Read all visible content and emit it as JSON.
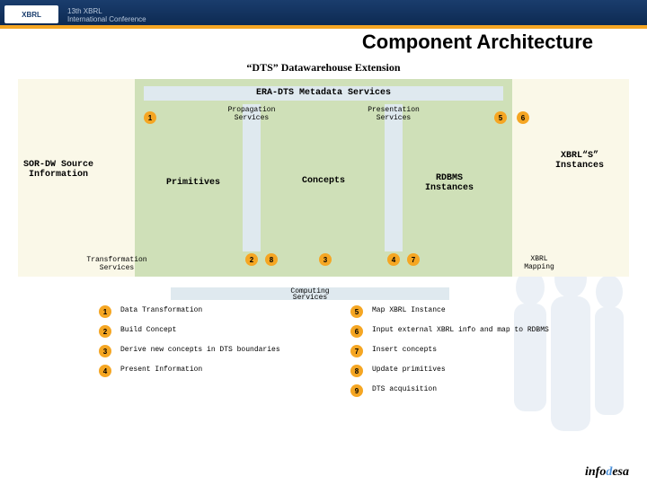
{
  "header": {
    "logo": "XBRL",
    "conf_line1": "13th XBRL",
    "conf_line2": "International Conference",
    "title": "Component Architecture",
    "subtitle": "“DTS” Datawarehouse Extension"
  },
  "diagram": {
    "meta_banner": "ERA-DTS Metadata Services",
    "propagation": "Propagation\nServices",
    "presentation": "Presentation\nServices",
    "sor": "SOR-DW Source Information",
    "primitives": "Primitives",
    "concepts": "Concepts",
    "rdbms": "RDBMS Instances",
    "xbrl_s": "XBRL“S” Instances",
    "transformation": "Transformation\nServices",
    "xbrl_mapping": "XBRL\nMapping",
    "computing": "Computing\nServices",
    "circles": {
      "top_left": "1",
      "top_r1": "5",
      "top_r2": "6",
      "bot_a": "2",
      "bot_b": "8",
      "bot_c": "3",
      "bot_d": "4",
      "bot_e": "7"
    }
  },
  "legend": {
    "rows": [
      {
        "l_num": "1",
        "l_text": "Data Transformation",
        "r_num": "5",
        "r_text": "Map XBRL Instance"
      },
      {
        "l_num": "2",
        "l_text": "Build Concept",
        "r_num": "6",
        "r_text": "Input external XBRL info and map to RDBMS"
      },
      {
        "l_num": "3",
        "l_text": "Derive new concepts in DTS boundaries",
        "r_num": "7",
        "r_text": "Insert concepts"
      },
      {
        "l_num": "4",
        "l_text": "Present Information",
        "r_num": "8",
        "r_text": "Update primitives"
      },
      {
        "l_num": "",
        "l_text": "",
        "r_num": "9",
        "r_text": "DTS acquisition"
      }
    ]
  },
  "footer": {
    "brand_pre": "info",
    "brand_d": "d",
    "brand_post": "esa"
  }
}
